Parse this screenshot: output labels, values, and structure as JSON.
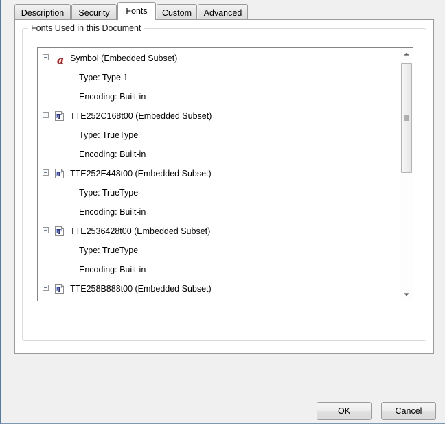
{
  "dialog": {
    "tabs": [
      {
        "label": "Description",
        "active": false
      },
      {
        "label": "Security",
        "active": false
      },
      {
        "label": "Fonts",
        "active": true
      },
      {
        "label": "Custom",
        "active": false
      },
      {
        "label": "Advanced",
        "active": false
      }
    ],
    "groupbox_label": "Fonts Used in this Document",
    "buttons": {
      "ok": "OK",
      "cancel": "Cancel"
    }
  },
  "font_list": [
    {
      "name": "Symbol (Embedded Subset)",
      "icon": "type1-font-icon",
      "toggle": "collapse-minus-icon",
      "details": [
        {
          "label": "Type: Type 1"
        },
        {
          "label": "Encoding: Built-in"
        }
      ]
    },
    {
      "name": "TTE252C168t00 (Embedded Subset)",
      "icon": "truetype-font-icon",
      "toggle": "collapse-minus-icon",
      "details": [
        {
          "label": "Type: TrueType"
        },
        {
          "label": "Encoding: Built-in"
        }
      ]
    },
    {
      "name": "TTE252E448t00 (Embedded Subset)",
      "icon": "truetype-font-icon",
      "toggle": "collapse-minus-icon",
      "details": [
        {
          "label": "Type: TrueType"
        },
        {
          "label": "Encoding: Built-in"
        }
      ]
    },
    {
      "name": "TTE2536428t00 (Embedded Subset)",
      "icon": "truetype-font-icon",
      "toggle": "collapse-minus-icon",
      "details": [
        {
          "label": "Type: TrueType"
        },
        {
          "label": "Encoding: Built-in"
        }
      ]
    },
    {
      "name": "TTE258B888t00 (Embedded Subset)",
      "icon": "truetype-font-icon",
      "toggle": "collapse-minus-icon",
      "details": []
    }
  ],
  "scrollbar": {
    "up_icon": "scroll-up-arrow-icon",
    "down_icon": "scroll-down-arrow-icon",
    "thumb": "scrollbar-thumb"
  },
  "glyphs": {
    "type1_symbol": "a"
  },
  "colors": {
    "type1_icon_red": "#c01a1a",
    "truetype_icon_blue": "#1b2fb0",
    "window_border": "#5b7a95",
    "tab_border": "#9a9a9a",
    "listbox_border": "#848484",
    "groupbox_border": "#d8dce0"
  }
}
